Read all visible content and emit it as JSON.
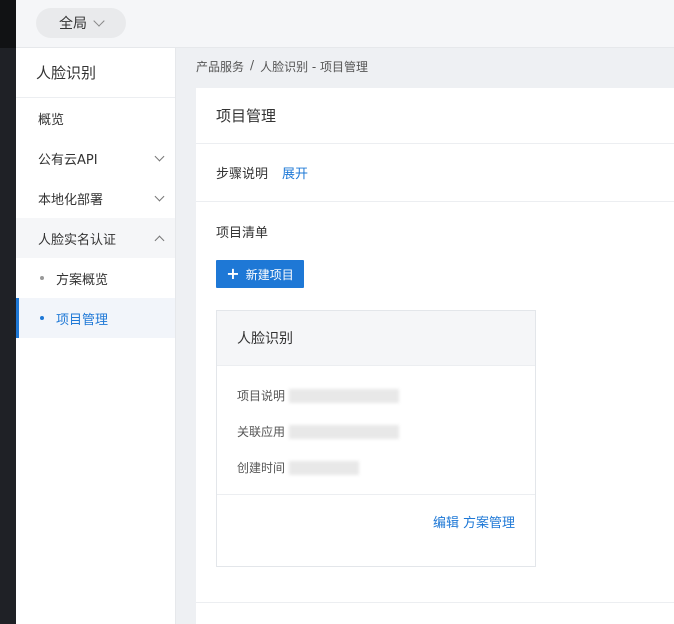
{
  "topbar": {
    "region_label": "全局"
  },
  "sidebar": {
    "title": "人脸识别",
    "items": [
      {
        "label": "概览"
      },
      {
        "label": "公有云API"
      },
      {
        "label": "本地化部署"
      },
      {
        "label": "人脸实名认证"
      }
    ],
    "sub_items": [
      {
        "label": "方案概览"
      },
      {
        "label": "项目管理"
      }
    ]
  },
  "breadcrumb": {
    "part1": "产品服务",
    "sep": "/",
    "part2": "人脸识别 - 项目管理"
  },
  "main": {
    "title": "项目管理",
    "steps_label": "步骤说明",
    "expand_link": "展开",
    "list_title": "项目清单",
    "new_button": "新建项目"
  },
  "card": {
    "title": "人脸识别",
    "desc_label": "项目说明",
    "app_label": "关联应用",
    "time_label": "创建时间",
    "edit_link": "编辑",
    "manage_link": "方案管理"
  },
  "colors": {
    "accent": "#1e78d6"
  }
}
